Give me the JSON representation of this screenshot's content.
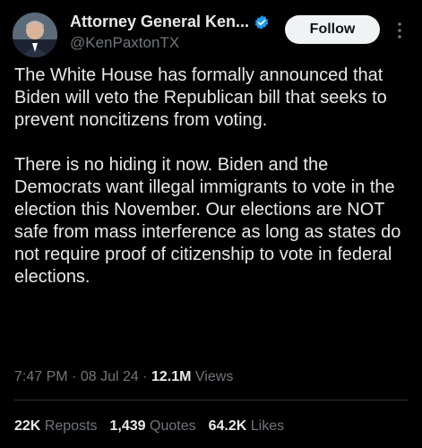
{
  "author": {
    "display_name": "Attorney General Ken...",
    "handle": "@KenPaxtonTX",
    "verified_icon": "verified-badge-icon"
  },
  "follow_label": "Follow",
  "more_icon": "more-options-icon",
  "tweet": {
    "paragraphs": [
      "The White House has formally announced that Biden will veto the Republican bill that seeks to prevent noncitizens from voting.",
      "There is no hiding it now. Biden and the Democrats want illegal immigrants to vote in the election this November. Our elections are NOT safe from mass interference as long as states do not require proof of citizenship to vote in federal elections."
    ]
  },
  "meta": {
    "time": "7:47 PM",
    "date": "08 Jul 24",
    "views_count": "12.1M",
    "views_label": "Views"
  },
  "stats": {
    "reposts_value": "22K",
    "reposts_label": "Reposts",
    "quotes_value": "1,439",
    "quotes_label": "Quotes",
    "likes_value": "64.2K",
    "likes_label": "Likes"
  },
  "colors": {
    "background": "#000000",
    "text": "#e7e9ea",
    "secondary": "#71767b",
    "verified": "#1d9bf0"
  }
}
